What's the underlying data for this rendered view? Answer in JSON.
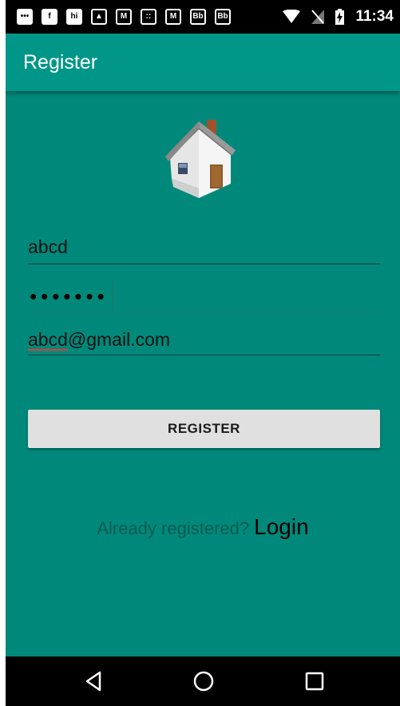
{
  "status_bar": {
    "time": "11:34",
    "notification_icons": [
      "chat-icon",
      "facebook-icon",
      "hi-icon",
      "image-icon",
      "gmail-icon",
      "calculator-icon",
      "gmail-icon",
      "blackboard-icon",
      "blackboard-icon"
    ],
    "icon_glyphs": [
      "•••",
      "f",
      "hi",
      "▲",
      "M",
      "::",
      "M",
      "Bb",
      "Bb"
    ]
  },
  "app_bar": {
    "title": "Register"
  },
  "form": {
    "username_value": "abcd",
    "password_mask": "•••••••",
    "email_value_underlined": "abcd",
    "email_value_rest": "@gmail.com"
  },
  "register_button": {
    "label": "REGISTER"
  },
  "login_row": {
    "prompt": "Already registered?",
    "link": "Login"
  },
  "colors": {
    "accent": "#009688",
    "background": "#00897b",
    "button": "#e0e0e0"
  }
}
